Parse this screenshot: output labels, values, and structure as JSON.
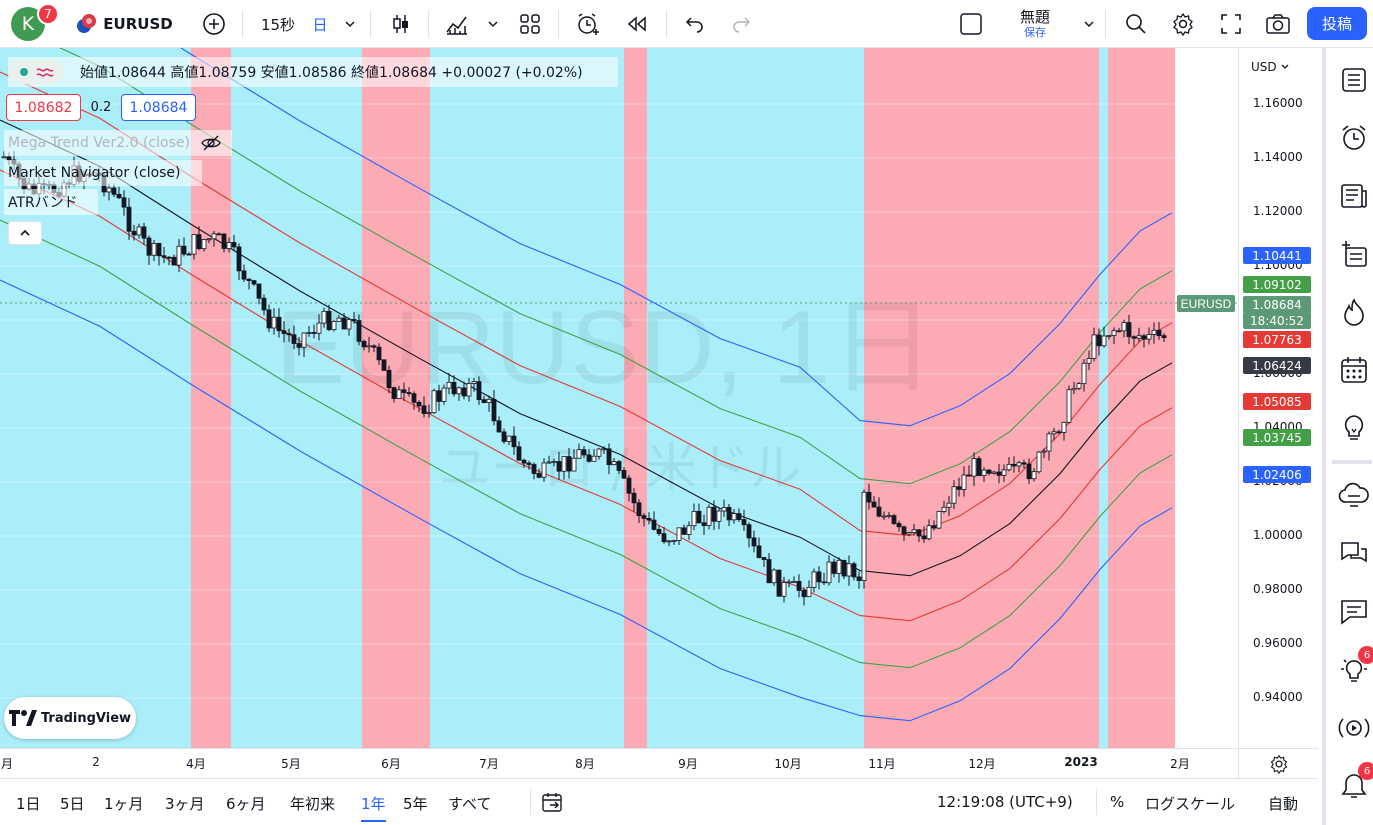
{
  "topbar": {
    "avatar_letter": "K",
    "avatar_badge": "7",
    "symbol": "EURUSD",
    "interval": "15秒",
    "chart_style": "日",
    "layout_name": "無題",
    "layout_save": "保存",
    "post_label": "投稿"
  },
  "legend": {
    "ohlc": "始値1.08644 高値1.08759 安値1.08586 終値1.08684 +0.00027 (+0.02%)",
    "bid": "1.08682",
    "spread": "0.2",
    "ask": "1.08684",
    "indicators": [
      "Mega Trend Ver2.0 (close)",
      "Market Navigator (close)",
      "ATRバンド"
    ]
  },
  "watermark": {
    "line1": "EURUSD, 1日",
    "line2": "ユーロ / 米ドル"
  },
  "price_axis": {
    "currency": "USD",
    "ticks": [
      "1.16000",
      "1.14000",
      "1.12000",
      "1.10000",
      "1.08000",
      "1.06000",
      "1.04000",
      "1.02000",
      "1.00000",
      "0.98000",
      "0.96000",
      "0.94000"
    ],
    "labels": [
      {
        "text": "1.10441",
        "color": "#2962ff"
      },
      {
        "text": "1.09102",
        "color": "#43a047"
      },
      {
        "text": "1.08684",
        "color": "#5b9a74"
      },
      {
        "text": "18:40:52",
        "color": "#5b9a74"
      },
      {
        "text": "1.07763",
        "color": "#e53935"
      },
      {
        "text": "1.06424",
        "color": "#363a45"
      },
      {
        "text": "1.05085",
        "color": "#e53935"
      },
      {
        "text": "1.03745",
        "color": "#43a047"
      },
      {
        "text": "1.02406",
        "color": "#2962ff"
      }
    ],
    "symbol_tag": "EURUSD"
  },
  "time_axis": [
    "月",
    "2",
    "4月",
    "5月",
    "6月",
    "7月",
    "8月",
    "9月",
    "10月",
    "11月",
    "12月",
    "2023",
    "2月"
  ],
  "bottom": {
    "ranges": [
      "1日",
      "5日",
      "1ヶ月",
      "3ヶ月",
      "6ヶ月",
      "年初来",
      "1年",
      "5年",
      "すべて"
    ],
    "active_range": "1年",
    "clock": "12:19:08 (UTC+9)",
    "percent": "%",
    "log": "ログスケール",
    "auto": "自動"
  },
  "sidebar": {
    "badge_ideas": "6",
    "badge_alerts": "6"
  },
  "brand": "TradingView",
  "colors": {
    "accent": "#2962ff",
    "bull_bg": "#aaeefa",
    "bear_bg": "#fcaab4"
  },
  "chart_data": {
    "type": "line",
    "price_min": 0.93,
    "price_max": 1.17
  }
}
